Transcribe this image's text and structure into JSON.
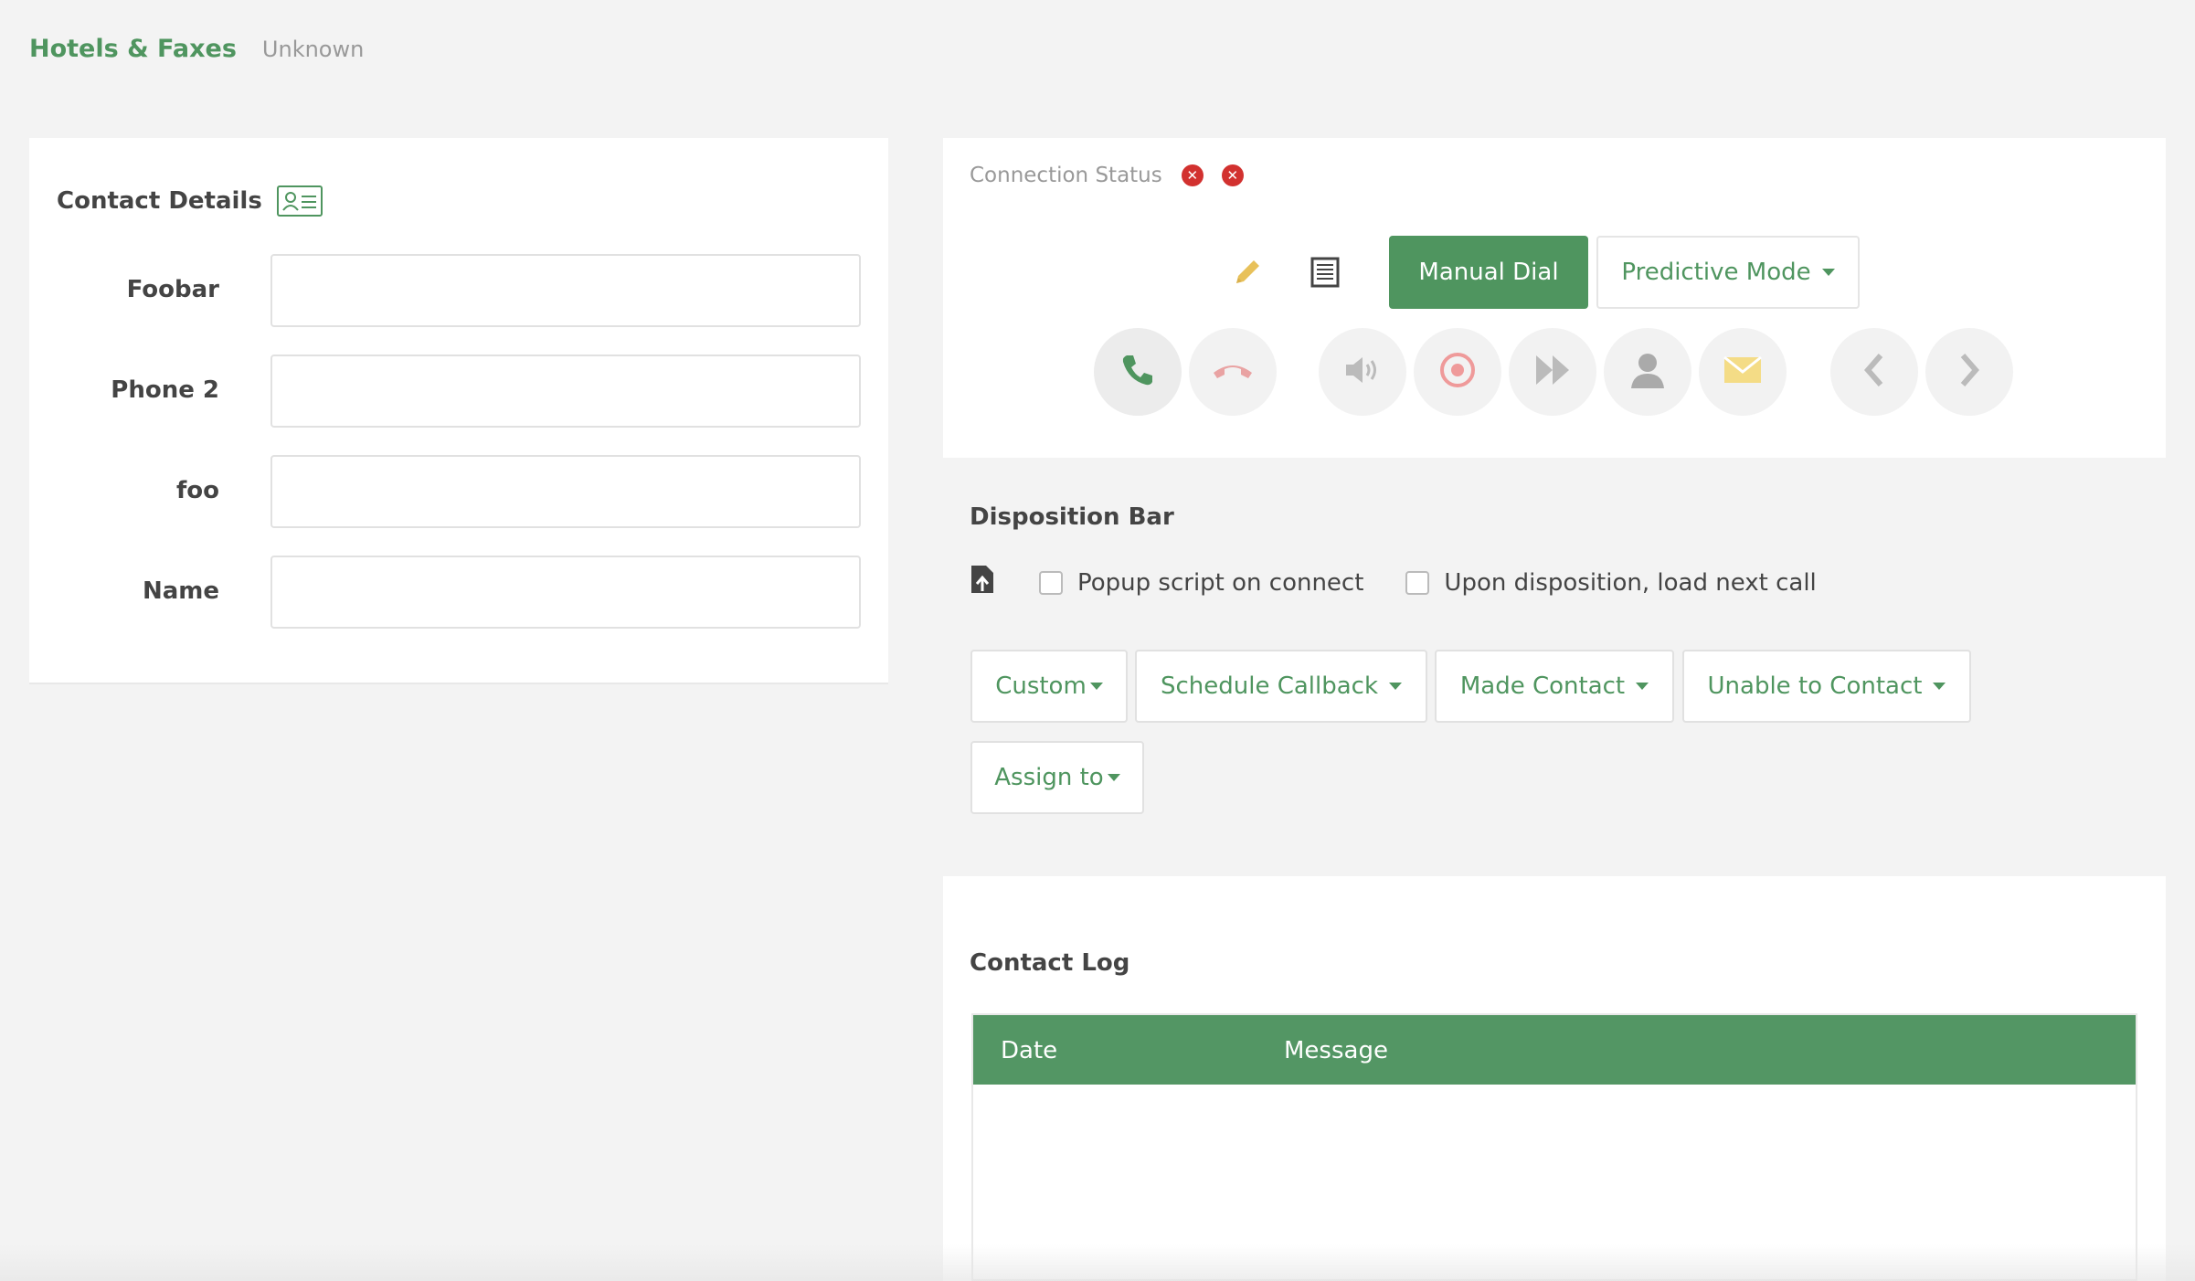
{
  "header": {
    "title": "Hotels & Faxes",
    "subtitle": "Unknown"
  },
  "contact": {
    "title": "Contact Details",
    "fields": [
      {
        "label": "Foobar",
        "value": ""
      },
      {
        "label": "Phone 2",
        "value": ""
      },
      {
        "label": "foo",
        "value": ""
      },
      {
        "label": "Name",
        "value": ""
      }
    ]
  },
  "dialer": {
    "connection_label": "Connection Status",
    "manual_dial": "Manual Dial",
    "mode": "Predictive Mode",
    "icons": [
      "pencil-icon",
      "list-icon",
      "phone-icon",
      "hangup-icon",
      "volume-icon",
      "record-icon",
      "fast-forward-icon",
      "user-icon",
      "mail-icon",
      "chevron-left-icon",
      "chevron-right-icon"
    ]
  },
  "disposition": {
    "title": "Disposition Bar",
    "popup_label": "Popup script on connect",
    "popup_checked": false,
    "load_next_label": "Upon disposition, load next call",
    "load_next_checked": false,
    "buttons": [
      "Custom",
      "Schedule Callback",
      "Made Contact",
      "Unable to Contact",
      "Assign to"
    ]
  },
  "log": {
    "title": "Contact Log",
    "columns": [
      "Date",
      "Message"
    ],
    "rows": []
  },
  "colors": {
    "accent": "#4f955f",
    "danger": "#d2312f",
    "hangup": "#e9a3a3",
    "mail": "#f4dc86",
    "pencil": "#e8c15a"
  }
}
